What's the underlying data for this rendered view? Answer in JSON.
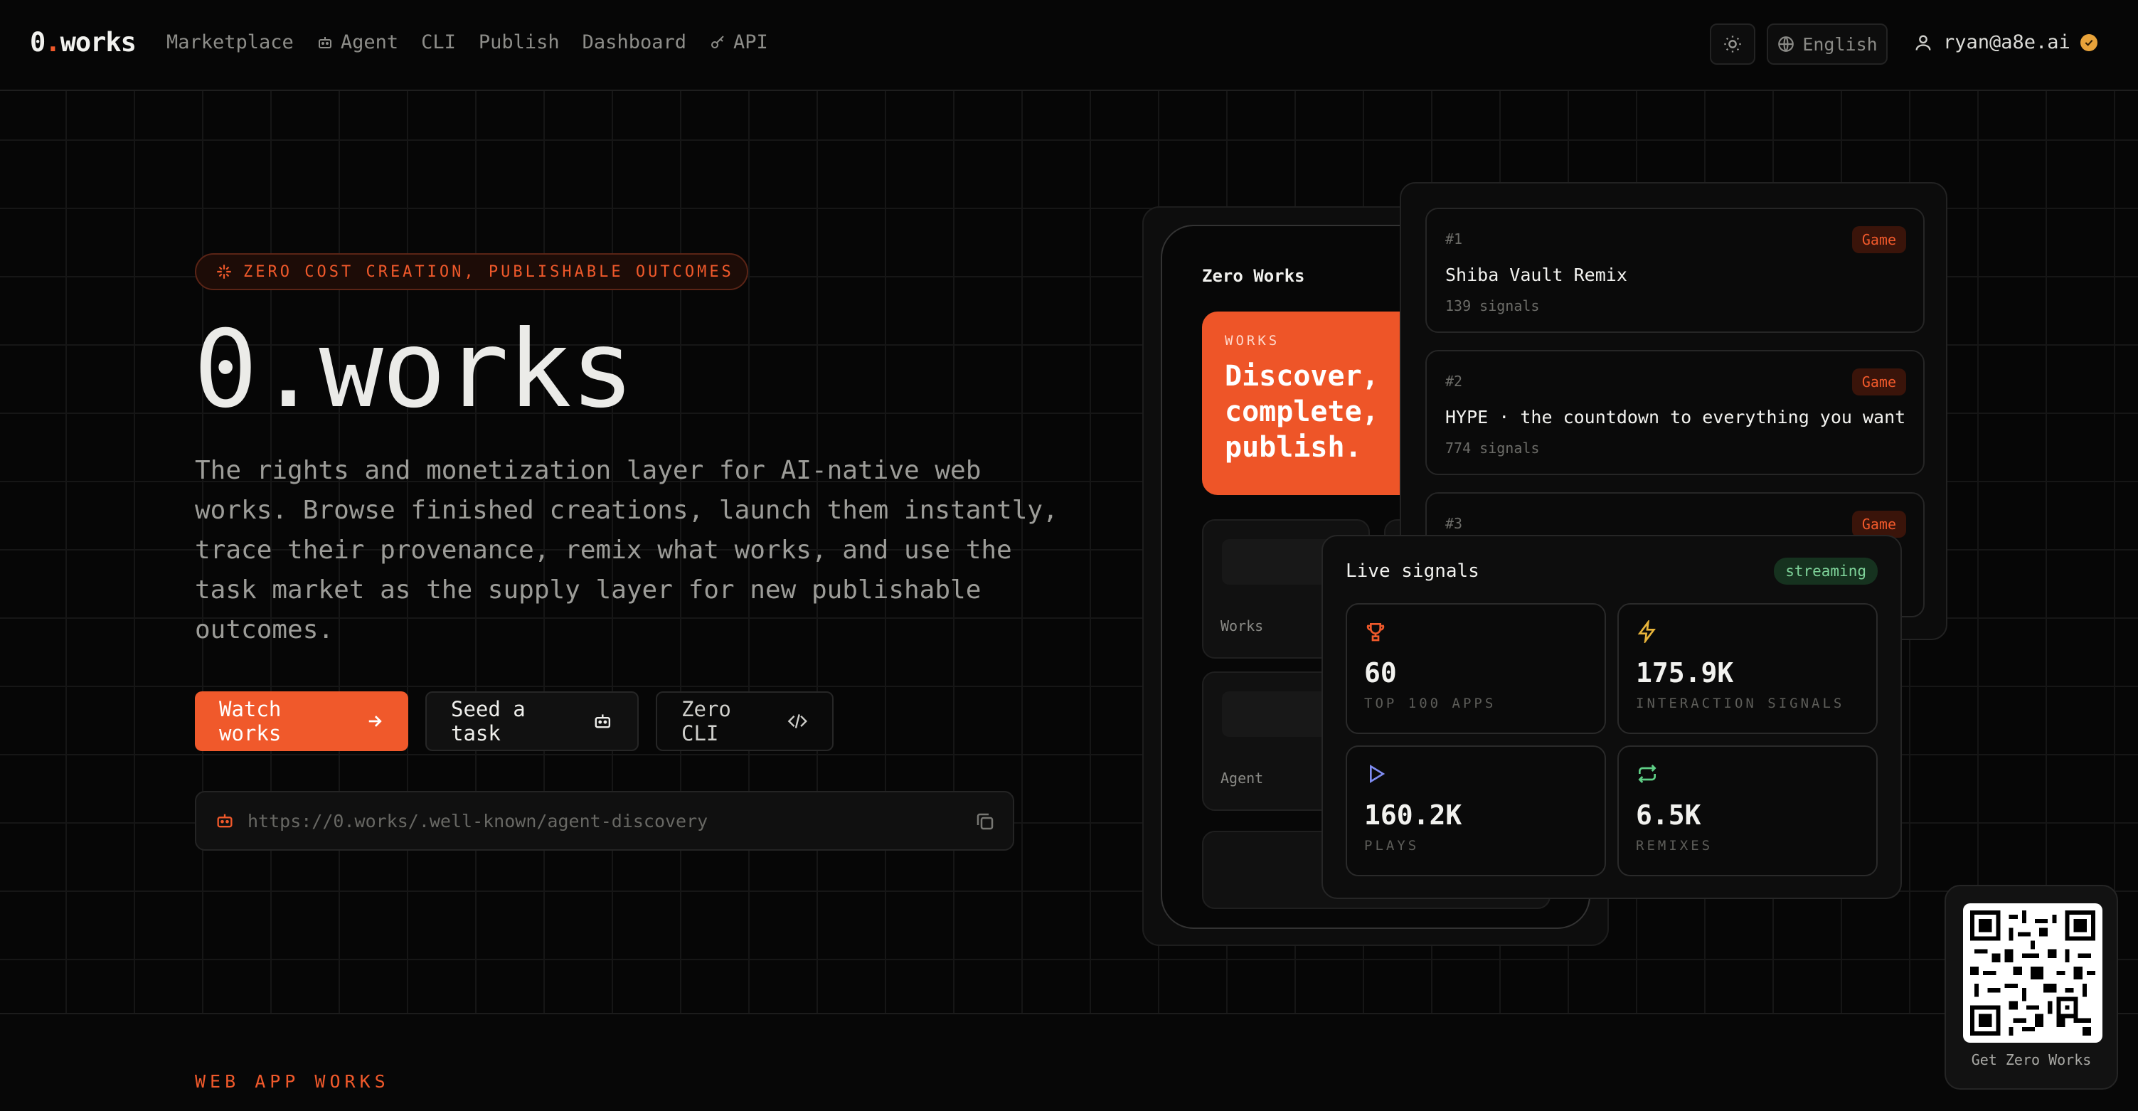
{
  "header": {
    "logo_prefix": "0",
    "logo_dot": ".",
    "logo_suffix": "works",
    "nav": [
      {
        "label": "Marketplace",
        "icon": ""
      },
      {
        "label": "Agent",
        "icon": "robot-icon"
      },
      {
        "label": "CLI",
        "icon": ""
      },
      {
        "label": "Publish",
        "icon": ""
      },
      {
        "label": "Dashboard",
        "icon": ""
      },
      {
        "label": "API",
        "icon": "key-icon"
      }
    ],
    "language": "English",
    "user_email": "ryan@a8e.ai"
  },
  "hero": {
    "badge": "ZERO COST CREATION, PUBLISHABLE OUTCOMES",
    "title": "0.works",
    "description": "The rights and monetization layer for AI-native web works. Browse finished creations, launch them instantly, trace their provenance, remix what works, and use the task market as the supply layer for new publishable outcomes.",
    "buttons": {
      "watch": "Watch works",
      "seed": "Seed a task",
      "cli": "Zero CLI"
    },
    "discovery_url": "https://0.works/.well-known/agent-discovery"
  },
  "device": {
    "title": "Zero Works",
    "card_kicker": "WORKS",
    "card_headline_1": "Discover,",
    "card_headline_2": "complete,",
    "card_headline_3": "publish.",
    "tile_1": "Works",
    "tile_2": "Agent"
  },
  "ranking": [
    {
      "rank": "#1",
      "tag": "Game",
      "title": "Shiba Vault Remix",
      "signals": "139 signals"
    },
    {
      "rank": "#2",
      "tag": "Game",
      "title": "HYPE · the countdown to everything you want",
      "signals": "774 signals"
    },
    {
      "rank": "#3",
      "tag": "Game",
      "title": "",
      "signals": ""
    }
  ],
  "live": {
    "title": "Live signals",
    "status": "streaming",
    "stats": [
      {
        "value": "60",
        "caption": "TOP 100 APPS",
        "icon": "trophy-icon",
        "color": "#f0592b"
      },
      {
        "value": "175.9K",
        "caption": "INTERACTION SIGNALS",
        "icon": "bolt-icon",
        "color": "#e8b43a"
      },
      {
        "value": "160.2K",
        "caption": "PLAYS",
        "icon": "play-icon",
        "color": "#7f8cf0"
      },
      {
        "value": "6.5K",
        "caption": "REMIXES",
        "icon": "repeat-icon",
        "color": "#5fcf86"
      }
    ]
  },
  "section": {
    "label": "WEB APP WORKS"
  },
  "qr": {
    "label": "Get Zero Works"
  },
  "colors": {
    "accent": "#f0592b",
    "background": "#060606"
  }
}
